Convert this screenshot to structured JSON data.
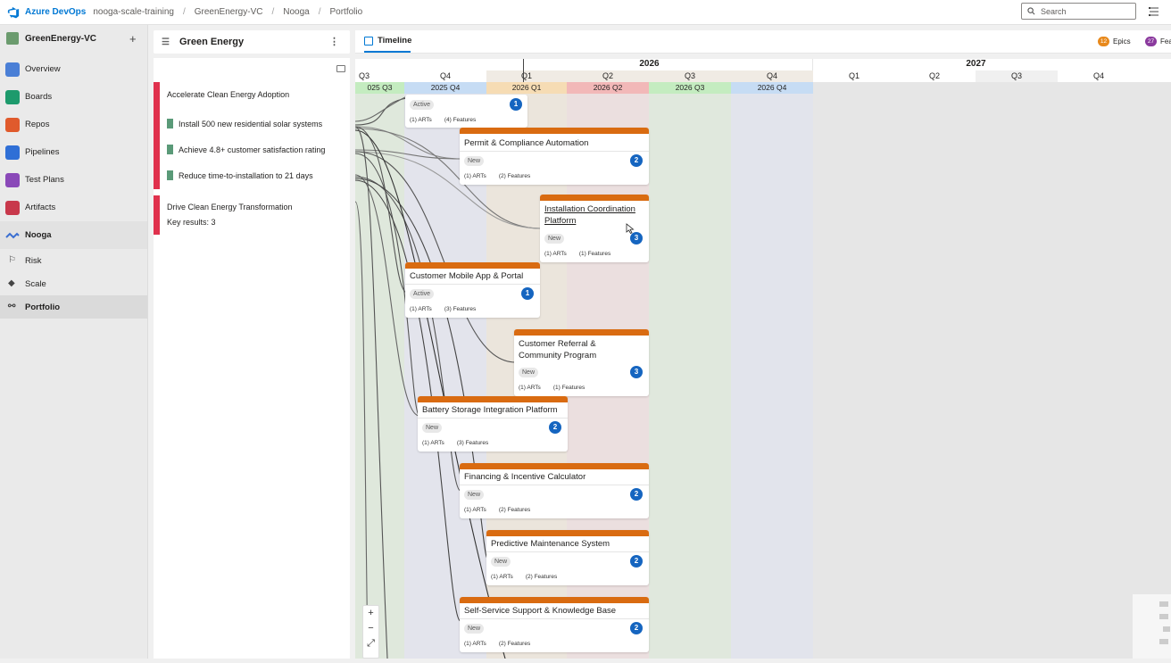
{
  "topbar": {
    "brand": "Azure DevOps",
    "breadcrumbs": [
      "nooga-scale-training",
      "GreenEnergy-VC",
      "Nooga",
      "Portfolio"
    ],
    "search_placeholder": "Search"
  },
  "nav": {
    "project": "GreenEnergy-VC",
    "items": [
      {
        "label": "Overview",
        "color": "#4a7fd6"
      },
      {
        "label": "Boards",
        "color": "#1d9a6c"
      },
      {
        "label": "Repos",
        "color": "#e05a2c"
      },
      {
        "label": "Pipelines",
        "color": "#2f6fd6"
      },
      {
        "label": "Test Plans",
        "color": "#8a49b8"
      },
      {
        "label": "Artifacts",
        "color": "#c8384b"
      }
    ],
    "section": "Nooga",
    "sub_items": [
      "Risk",
      "Scale",
      "Portfolio"
    ]
  },
  "okr": {
    "title": "Green Energy",
    "objective1": "Accelerate Clean Energy Adoption",
    "key_results": [
      "Install 500 new residential solar systems",
      "Achieve 4.8+ customer satisfaction rating",
      "Reduce time-to-installation to 21 days"
    ],
    "objective2": "Drive Clean Energy Transformation",
    "objective2_sub": "Key results: 3"
  },
  "timeline": {
    "tab": "Timeline",
    "legend": [
      {
        "count": "12",
        "label": "Epics",
        "color": "#e8891c"
      },
      {
        "count": "27",
        "label": "Fea",
        "color": "#8b3a9e"
      }
    ],
    "years": [
      "2026",
      "2027"
    ],
    "quarter_headers": [
      "Q3",
      "Q4",
      "Q1",
      "Q2",
      "Q3",
      "Q4",
      "Q1",
      "Q2",
      "Q3",
      "Q4"
    ],
    "quarter_columns": [
      "025 Q3",
      "2025 Q4",
      "2026 Q1",
      "2026 Q2",
      "2026 Q3",
      "2026 Q4"
    ]
  },
  "cards": [
    {
      "title": "",
      "status": "Active",
      "count": "1",
      "arts": "(1) ARTs",
      "features": "(4) Features"
    },
    {
      "title": "Permit & Compliance Automation",
      "status": "New",
      "count": "2",
      "arts": "(1) ARTs",
      "features": "(2) Features"
    },
    {
      "title": "Installation Coordination Platform",
      "status": "New",
      "count": "3",
      "arts": "(1) ARTs",
      "features": "(1) Features"
    },
    {
      "title": "Customer Mobile App & Portal",
      "status": "Active",
      "count": "1",
      "arts": "(1) ARTs",
      "features": "(3) Features"
    },
    {
      "title": "Customer Referral & Community Program",
      "status": "New",
      "count": "3",
      "arts": "(1) ARTs",
      "features": "(1) Features"
    },
    {
      "title": "Battery Storage Integration Platform",
      "status": "New",
      "count": "2",
      "arts": "(1) ARTs",
      "features": "(3) Features"
    },
    {
      "title": "Financing & Incentive Calculator",
      "status": "New",
      "count": "2",
      "arts": "(1) ARTs",
      "features": "(2) Features"
    },
    {
      "title": "Predictive Maintenance System",
      "status": "New",
      "count": "2",
      "arts": "(1) ARTs",
      "features": "(2) Features"
    },
    {
      "title": "Self-Service Support & Knowledge Base",
      "status": "New",
      "count": "2",
      "arts": "(1) ARTs",
      "features": "(2) Features"
    }
  ],
  "zoom": [
    "+",
    "−",
    "⤢"
  ]
}
